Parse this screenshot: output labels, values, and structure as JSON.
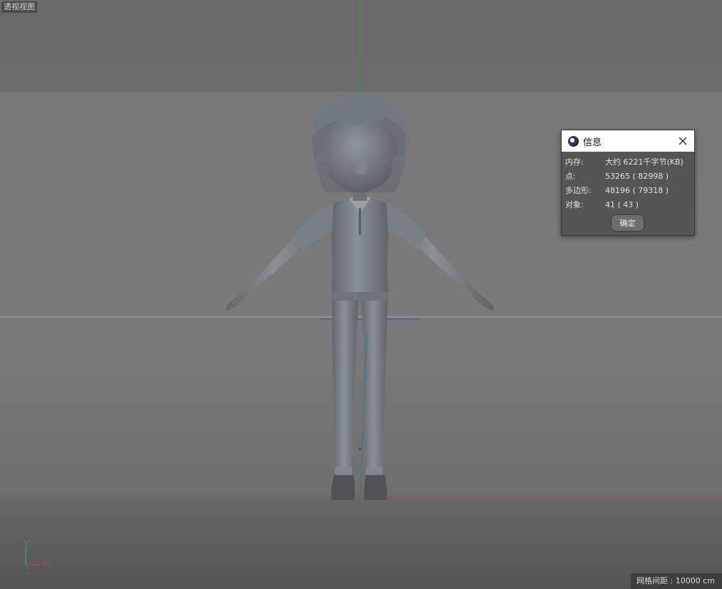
{
  "viewport": {
    "label": "透视视图",
    "grid_spacing": "网格间距 : 10000 cm"
  },
  "axis_gizmo": {
    "y": "Y",
    "x": "X",
    "z": "Z"
  },
  "info_dialog": {
    "title": "信息",
    "icon": "cinema4d-logo-icon",
    "rows": [
      {
        "key": "内存:",
        "value": "大约 6221千字节(KB)"
      },
      {
        "key": "点:",
        "value": "53265 ( 82998 )"
      },
      {
        "key": "多边形:",
        "value": "48196 ( 79318 )"
      },
      {
        "key": "对象:",
        "value": "41 ( 43 )"
      }
    ],
    "ok_label": "确定"
  },
  "colors": {
    "axis_x": "#c8413a",
    "axis_y": "#3aa84a",
    "axis_z": "#4a5fc8",
    "model": "#7d838a"
  }
}
